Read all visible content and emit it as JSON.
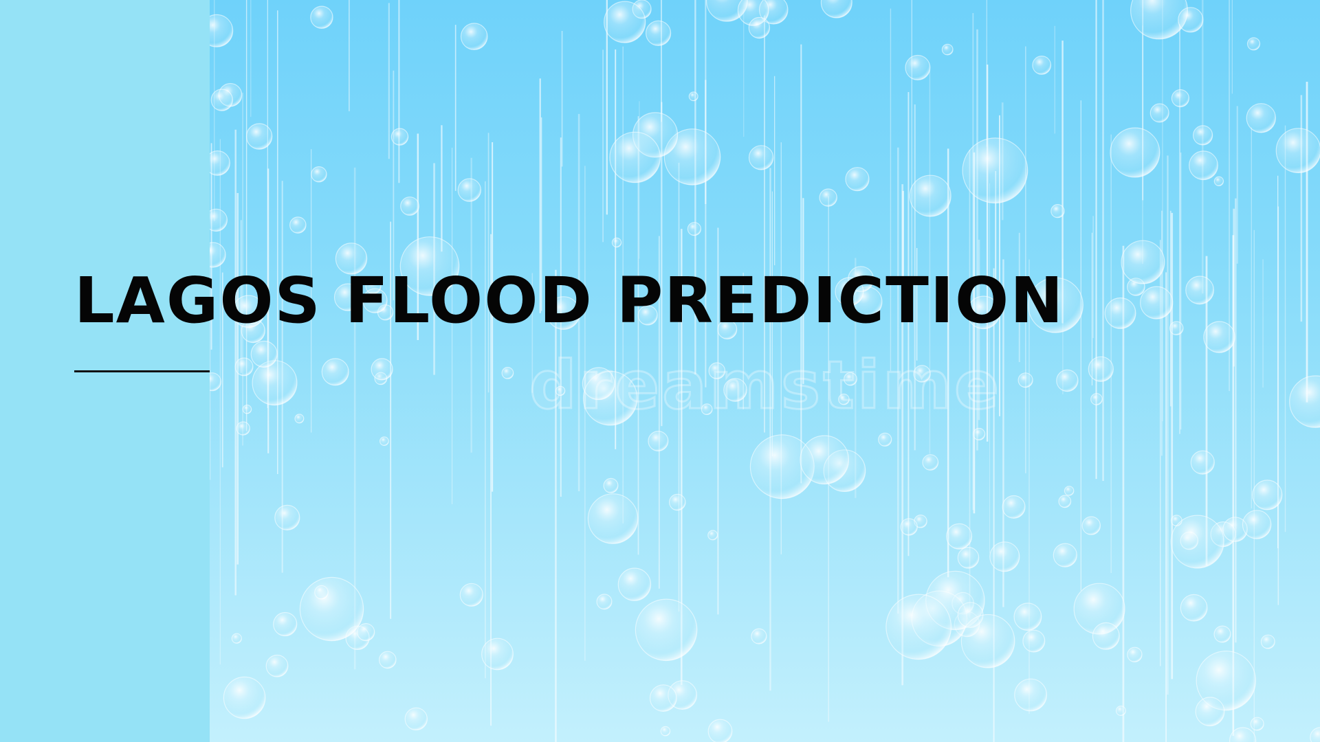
{
  "slide": {
    "title": "LAGOS FLOOD PREDICTION",
    "background_watermark": "dreamstime"
  },
  "colors": {
    "side_panel": "#95e2f6",
    "sky_top": "#6fd2fa",
    "sky_bottom": "#c3f0fd",
    "title_text": "#050505",
    "rule": "#111111"
  }
}
